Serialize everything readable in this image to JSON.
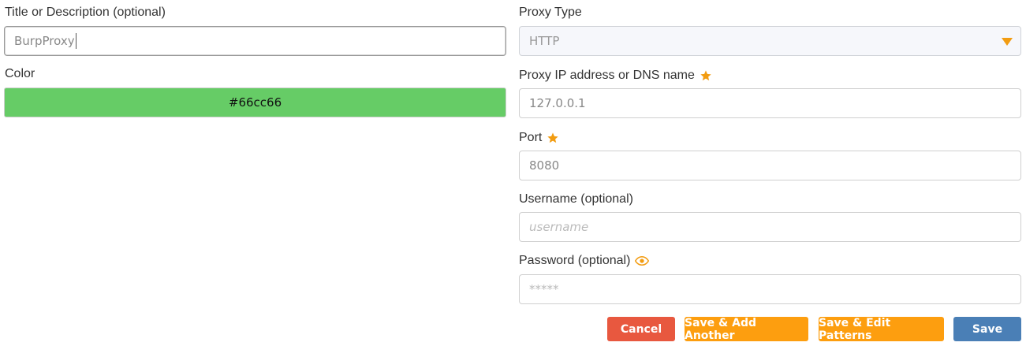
{
  "left": {
    "title_label": "Title or Description (optional)",
    "title_value": "BurpProxy",
    "color_label": "Color",
    "color_value": "#66cc66"
  },
  "right": {
    "proxy_type_label": "Proxy Type",
    "proxy_type_value": "HTTP",
    "ip_label": "Proxy IP address or DNS name",
    "ip_value": "127.0.0.1",
    "port_label": "Port",
    "port_value": "8080",
    "username_label": "Username (optional)",
    "username_placeholder": "username",
    "password_label": "Password (optional)",
    "password_placeholder": "*****"
  },
  "buttons": {
    "cancel": "Cancel",
    "save_add_another": "Save & Add Another",
    "save_edit_patterns": "Save & Edit Patterns",
    "save": "Save"
  },
  "colors": {
    "swatch": "#66cc66",
    "accent": "#f29c11",
    "cancel": "#e8583f",
    "orange": "#fd9e0f",
    "save": "#4a7fb6"
  },
  "icons": {
    "required": "star-icon",
    "reveal": "eye-icon",
    "dropdown": "triangle-down-icon"
  }
}
